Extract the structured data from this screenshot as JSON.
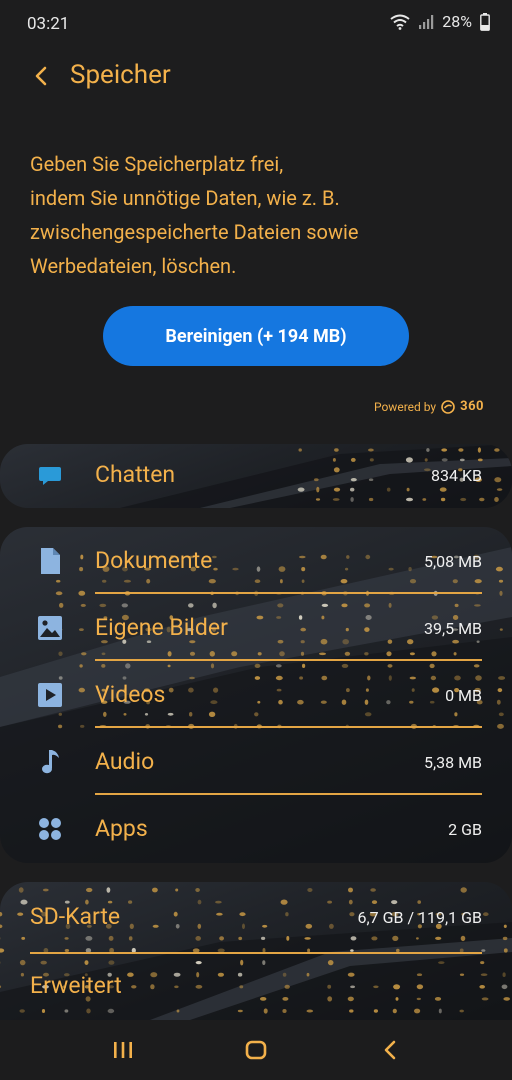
{
  "status": {
    "time": "03:21",
    "battery": "28%"
  },
  "header": {
    "title": "Speicher"
  },
  "description": {
    "lines": [
      "Geben Sie Speicherplatz frei,",
      "indem Sie unnötige Daten, wie z. B.",
      "zwischengespeicherte Dateien sowie",
      "Werbedateien, löschen."
    ]
  },
  "clean_button": {
    "label": "Bereinigen (+ 194 MB)"
  },
  "powered": {
    "prefix": "Powered by",
    "brand": "360"
  },
  "chat": {
    "label": "Chatten",
    "value": "834 KB",
    "icon": "chat-bubble-icon"
  },
  "categories": [
    {
      "label": "Dokumente",
      "value": "5,08 MB",
      "icon": "document-icon"
    },
    {
      "label": "Eigene Bilder",
      "value": "39,5 MB",
      "icon": "image-icon"
    },
    {
      "label": "Videos",
      "value": "0 MB",
      "icon": "video-icon"
    },
    {
      "label": "Audio",
      "value": "5,38 MB",
      "icon": "music-note-icon"
    },
    {
      "label": "Apps",
      "value": "2 GB",
      "icon": "apps-icon"
    }
  ],
  "storage": [
    {
      "label": "SD-Karte",
      "value": "6,7 GB / 119,1 GB"
    },
    {
      "label": "Erweitert",
      "value": ""
    }
  ],
  "colors": {
    "accent": "#f3b14b",
    "button": "#1577e0",
    "icon": "#6fa6d8",
    "background": "#1d1d1e"
  }
}
